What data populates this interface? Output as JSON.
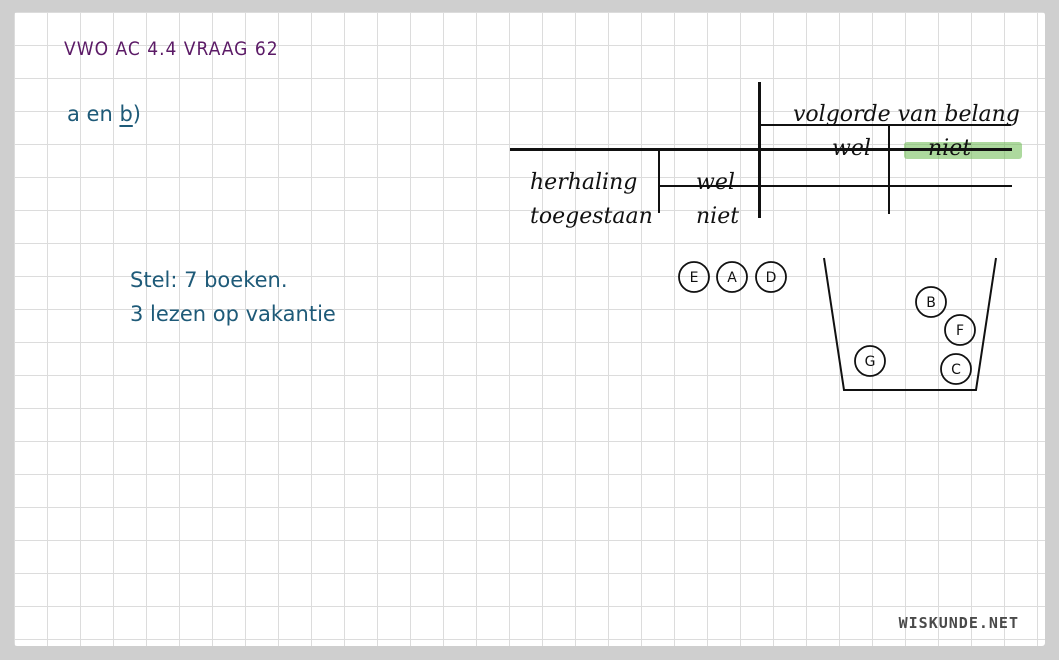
{
  "title": "VWO AC 4.4 VRAAG 62",
  "part_label": {
    "prefix": "a en ",
    "letter": "b",
    "suffix": ")"
  },
  "notes": {
    "line1": "Stel: 7 boeken.",
    "line2": "3 lezen op vakantie"
  },
  "table": {
    "title": "volgorde van belang",
    "col_wel": "wel",
    "col_niet": "niet",
    "row_title_1": "herhaling",
    "row_title_2": "toegestaan",
    "row_wel": "wel",
    "row_niet": "niet",
    "highlight_color": "#6ab94e"
  },
  "drawing": {
    "outside_balls": [
      "E",
      "A",
      "D"
    ],
    "bucket_balls": [
      "B",
      "F",
      "G",
      "C"
    ]
  },
  "watermark": "WISKUNDE.NET"
}
